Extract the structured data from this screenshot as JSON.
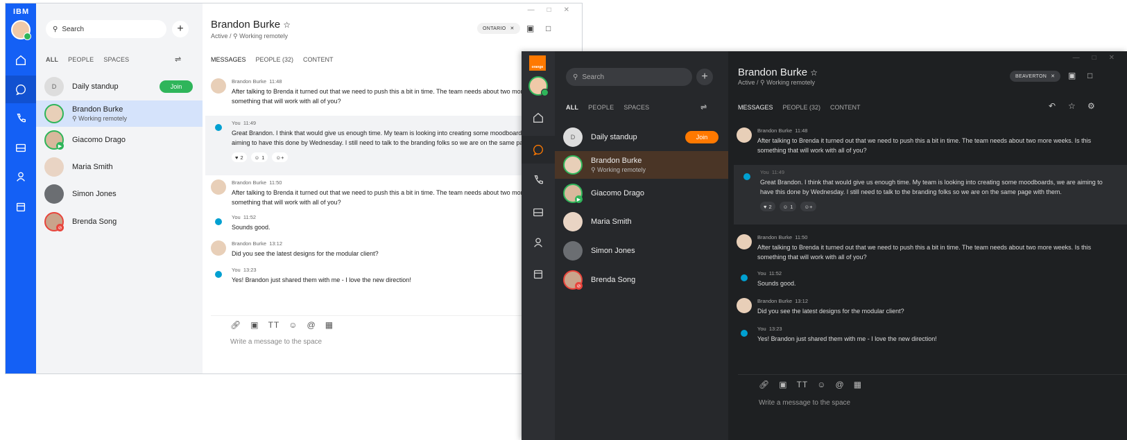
{
  "light": {
    "logo": "IBM",
    "search": {
      "placeholder": "Search"
    },
    "filters": [
      "ALL",
      "PEOPLE",
      "SPACES"
    ],
    "contacts": [
      {
        "name": "Daily standup",
        "initial": "D",
        "join": "Join"
      },
      {
        "name": "Brandon Burke",
        "sub": "Working remotely"
      },
      {
        "name": "Giacomo Drago"
      },
      {
        "name": "Maria Smith"
      },
      {
        "name": "Simon Jones"
      },
      {
        "name": "Brenda Song"
      }
    ],
    "header": {
      "name": "Brandon Burke",
      "status": "Active",
      "location": "Working remotely",
      "chip": "ONTARIO"
    },
    "tabs": [
      "MESSAGES",
      "PEOPLE (32)",
      "CONTENT"
    ],
    "messages": [
      {
        "author": "Brandon Burke",
        "time": "11:48",
        "text": "After talking to Brenda it turned out that we need to push this a bit in time. The team needs about two more weeks. Is this something that will work with all of you?"
      },
      {
        "author": "You",
        "time": "11:49",
        "text": "Great Brandon. I think that would give us enough time. My team is looking into creating some moodboards, we are aiming to have this done by Wednesday. I still need to talk to the branding folks so we are on the same page with them.",
        "reactions": [
          "2",
          "1"
        ]
      },
      {
        "author": "Brandon Burke",
        "time": "11:50",
        "text": "After talking to Brenda it turned out that we need to push this a bit in time. The team needs about two more weeks. Is this something that will work with all of you?"
      },
      {
        "author": "You",
        "time": "11:52",
        "text": "Sounds good."
      },
      {
        "author": "Brandon Burke",
        "time": "13:12",
        "text": "Did you see the latest designs for the modular client?"
      },
      {
        "author": "You",
        "time": "13:23",
        "text": "Yes! Brandon just shared them with me - I love the new direction!"
      }
    ],
    "composer": "Write a message to the space",
    "accent": "#1460f5"
  },
  "dark": {
    "logo": "orange",
    "search": {
      "placeholder": "Search"
    },
    "filters": [
      "ALL",
      "PEOPLE",
      "SPACES"
    ],
    "contacts": [
      {
        "name": "Daily standup",
        "initial": "D",
        "join": "Join"
      },
      {
        "name": "Brandon Burke",
        "sub": "Working remotely"
      },
      {
        "name": "Giacomo Drago"
      },
      {
        "name": "Maria Smith"
      },
      {
        "name": "Simon Jones"
      },
      {
        "name": "Brenda Song"
      }
    ],
    "header": {
      "name": "Brandon Burke",
      "status": "Active",
      "location": "Working remotely",
      "chip": "BEAVERTON"
    },
    "tabs": [
      "MESSAGES",
      "PEOPLE (32)",
      "CONTENT"
    ],
    "messages": [
      {
        "author": "Brandon Burke",
        "time": "11:48",
        "text": "After talking to Brenda it turned out that we need to push this a bit in time. The team needs about two more weeks. Is this something that will work with all of you?"
      },
      {
        "author": "You",
        "time": "11:49",
        "text": "Great Brandon. I think that would give us enough time. My team is looking into creating some moodboards, we are aiming to have this done by Wednesday. I still need to talk to the branding folks so we are on the same page with them.",
        "reactions": [
          "2",
          "1"
        ]
      },
      {
        "author": "Brandon Burke",
        "time": "11:50",
        "text": "After talking to Brenda it turned out that we need to push this a bit in time. The team needs about two more weeks. Is this something that will work with all of you?"
      },
      {
        "author": "You",
        "time": "11:52",
        "text": "Sounds good."
      },
      {
        "author": "Brandon Burke",
        "time": "13:12",
        "text": "Did you see the latest designs for the modular client?"
      },
      {
        "author": "You",
        "time": "13:23",
        "text": "Yes! Brandon just shared them with me - I love the new direction!"
      }
    ],
    "composer": "Write a message to the space",
    "accent": "#ff7900"
  },
  "icons": [
    "home-icon",
    "chat-icon",
    "phone-icon",
    "meetings-icon",
    "contacts-icon",
    "calendar-icon",
    "search-icon",
    "star-icon",
    "video-icon",
    "share-icon",
    "attach-icon",
    "whiteboard-icon",
    "format-icon",
    "emoji-icon",
    "mention-icon",
    "gif-icon"
  ]
}
